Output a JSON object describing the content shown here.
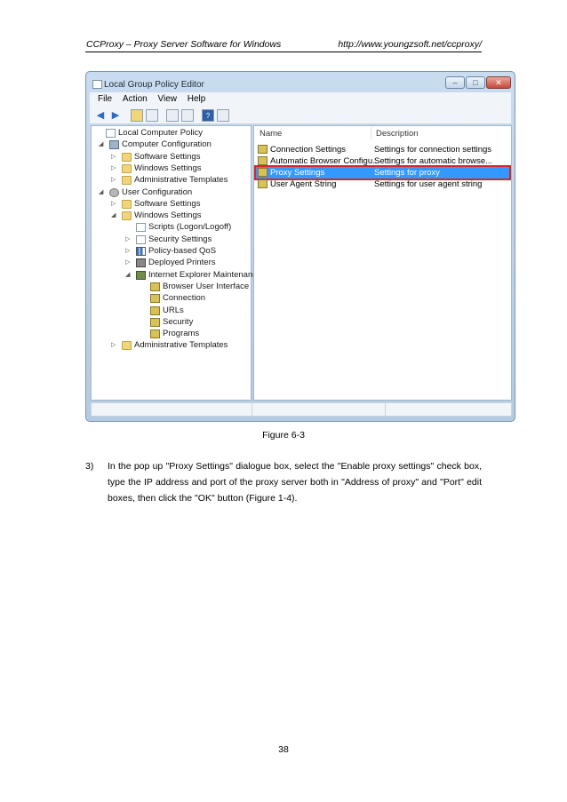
{
  "header": {
    "left": "CCProxy – Proxy Server Software for Windows",
    "right": "http://www.youngzsoft.net/ccproxy/"
  },
  "window": {
    "title": "Local Group Policy Editor",
    "menu": [
      "File",
      "Action",
      "View",
      "Help"
    ],
    "tree": [
      {
        "label": "Local Computer Policy",
        "toggle": "",
        "icon": "doc-icon"
      },
      {
        "label": "Computer Configuration",
        "toggle": "◢",
        "icon": "computer-icon"
      },
      {
        "label": "Software Settings",
        "toggle": "▷",
        "icon": "folder-icon"
      },
      {
        "label": "Windows Settings",
        "toggle": "▷",
        "icon": "folder-icon"
      },
      {
        "label": "Administrative Templates",
        "toggle": "▷",
        "icon": "folder-icon"
      },
      {
        "label": "User Configuration",
        "toggle": "◢",
        "icon": "user-icon"
      },
      {
        "label": "Software Settings",
        "toggle": "▷",
        "icon": "folder-icon"
      },
      {
        "label": "Windows Settings",
        "toggle": "◢",
        "icon": "folder-icon"
      },
      {
        "label": "Scripts (Logon/Logoff)",
        "toggle": "",
        "icon": "script-icon"
      },
      {
        "label": "Security Settings",
        "toggle": "▷",
        "icon": "security-icon"
      },
      {
        "label": "Policy-based QoS",
        "toggle": "▷",
        "icon": "qos-icon"
      },
      {
        "label": "Deployed Printers",
        "toggle": "▷",
        "icon": "printer-icon"
      },
      {
        "label": "Internet Explorer Maintenance",
        "toggle": "◢",
        "icon": "ie-maintenance-icon"
      },
      {
        "label": "Browser User Interface",
        "toggle": "",
        "icon": "ie-setting-icon"
      },
      {
        "label": "Connection",
        "toggle": "",
        "icon": "ie-setting-icon"
      },
      {
        "label": "URLs",
        "toggle": "",
        "icon": "ie-setting-icon"
      },
      {
        "label": "Security",
        "toggle": "",
        "icon": "ie-setting-icon"
      },
      {
        "label": "Programs",
        "toggle": "",
        "icon": "ie-setting-icon"
      },
      {
        "label": "Administrative Templates",
        "toggle": "▷",
        "icon": "folder-icon"
      }
    ],
    "columns": {
      "name": "Name",
      "description": "Description"
    },
    "rows": [
      {
        "name": "Connection Settings",
        "description": "Settings for connection settings"
      },
      {
        "name": "Automatic Browser Configu...",
        "description": "Settings for automatic browse..."
      },
      {
        "name": "Proxy Settings",
        "description": "Settings for proxy"
      },
      {
        "name": "User Agent String",
        "description": "Settings for user agent string"
      }
    ]
  },
  "figure_caption": "Figure 6-3",
  "step": {
    "number": "3)",
    "text": "In the pop up \"Proxy Settings\" dialogue box, select the \"Enable proxy settings\" check box, type the IP address and port of the proxy server both in \"Address of proxy\" and \"Port\" edit boxes, then click the \"OK\" button (Figure 1-4)."
  },
  "page_number": "38"
}
